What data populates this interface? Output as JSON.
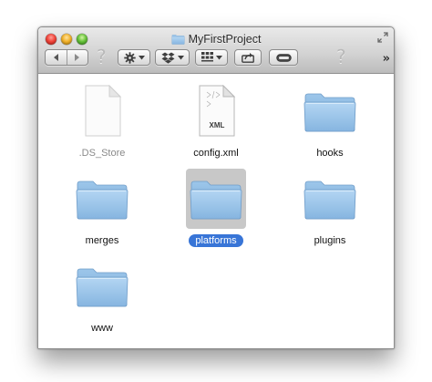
{
  "window": {
    "title": "MyFirstProject"
  },
  "toolbar": {
    "help_glyph": "?",
    "overflow_glyph": "»"
  },
  "files": [
    {
      "name": ".DS_Store",
      "kind": "document",
      "hidden": true
    },
    {
      "name": "config.xml",
      "kind": "xml-document",
      "badge": "XML"
    },
    {
      "name": "hooks",
      "kind": "folder"
    },
    {
      "name": "merges",
      "kind": "folder"
    },
    {
      "name": "platforms",
      "kind": "folder",
      "selected": true
    },
    {
      "name": "plugins",
      "kind": "folder"
    },
    {
      "name": "www",
      "kind": "folder"
    }
  ],
  "colors": {
    "selection": "#3875d7",
    "folder": "#8fbde6",
    "selected_icon_bg": "#c8c8c8"
  }
}
